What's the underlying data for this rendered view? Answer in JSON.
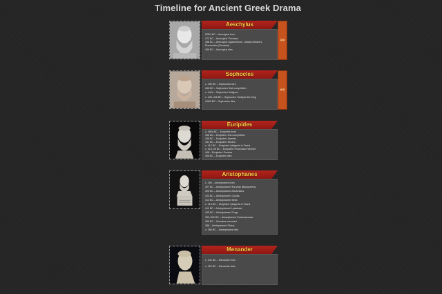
{
  "page": {
    "title": "Timeline for Ancient Greek Drama"
  },
  "entries": [
    {
      "name": "Aeschylus",
      "events": [
        "525/4 BC – Aeschylus born",
        "472 BC – Aeschylus' Persians",
        "458 BC – Aeschylus' Agamemnon, Libation Bearers,",
        "Eumenides (Oresteia)",
        "456 BC – Aeschylus dies"
      ],
      "nav": ">>"
    },
    {
      "name": "Sophocles",
      "events": [
        "c. 496 BC – Sophocles born",
        "468 BC – Sophocles' first competition",
        "c. 442a – Sophocles' Antigone",
        "c. 430–426 BC – Sophocles' Oedipus the King",
        "406/5 BC – Sophocles dies"
      ],
      "nav": "<<"
    },
    {
      "name": "Euripides",
      "events": [
        "c. 480a BC – Euripides born",
        "455 BC – Euripides' first competition",
        "438 BC – Euripides' Alcestis",
        "431 BC – Euripides' Medea",
        "c. 413 BC – Euripides' Iphigenia in Tauris",
        "c. 410–09 BC – Euripides' Phoenician Women",
        "408 – Euripides' Orestes",
        "406 BC – Euripides dies"
      ]
    },
    {
      "name": "Aristophanes",
      "events": [
        "c. 450 – Aristophanes born",
        "427 BC – Aristophanes' first play (Banqueters)",
        "425 BC – Aristophanes' Acharnians",
        "423 BC – Aristophanes' Clouds",
        "414 BC – Aristophanes' Birds",
        "c. 413 BC – Euripides' Iphigenia in Tauris",
        "411 BC – Aristophanes' Lysistrata",
        "405 BC – Aristophanes' Frogs",
        "392–391 BC – Aristophanes' Ecclesiazusae",
        "399 BC – Socrates executed",
        "388 – Aristophanes' Plutus",
        "c. 386 BC – Aristophanes dies"
      ]
    },
    {
      "name": "Menander",
      "events": [
        "c. 342 BC – Menander born",
        "c. 292 BC – Menander dies"
      ]
    }
  ]
}
